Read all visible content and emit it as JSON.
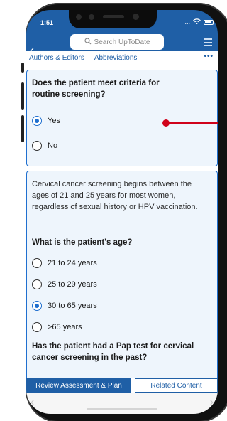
{
  "status": {
    "time": "1:51",
    "more_indicator": "..."
  },
  "header": {
    "back_glyph": "‹",
    "search_placeholder": "Search UpToDate",
    "search_icon": "search-icon",
    "menu_icon": "hamburger-menu-icon"
  },
  "tabs": {
    "items": [
      "Authors & Editors",
      "Abbreviations"
    ],
    "more": "•••"
  },
  "question1": {
    "title": "Does the patient meet criteria for routine screening?",
    "options": [
      "Yes",
      "No"
    ],
    "selected": "Yes"
  },
  "question2": {
    "info": "Cervical cancer screening begins between the ages of 21 and 25 years for most women, regardless of sexual history or HPV vaccination.",
    "title": "What is the patient's age?",
    "options": [
      "21 to 24 years",
      "25 to 29 years",
      "30 to 65 years",
      ">65 years"
    ],
    "selected": "30 to 65 years"
  },
  "question3": {
    "title": "Has the patient had a Pap test for cervical cancer screening in the past?"
  },
  "actions": {
    "primary": "Review Assessment & Plan",
    "secondary": "Related Content"
  },
  "colors": {
    "brand": "#1f5fa6",
    "accent": "#1f6fcf",
    "pointer": "#d0021b"
  }
}
